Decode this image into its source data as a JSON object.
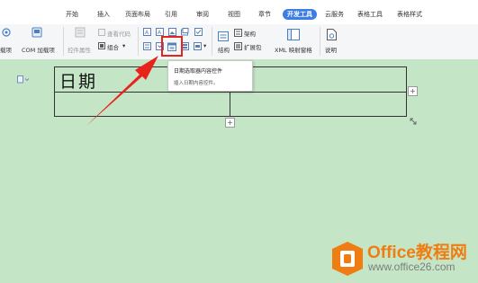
{
  "tabs": [
    {
      "label": "开始",
      "active": false
    },
    {
      "label": "插入",
      "active": false
    },
    {
      "label": "页面布局",
      "active": false
    },
    {
      "label": "引用",
      "active": false
    },
    {
      "label": "审阅",
      "active": false
    },
    {
      "label": "视图",
      "active": false
    },
    {
      "label": "章节",
      "active": false
    },
    {
      "label": "开发工具",
      "active": true
    },
    {
      "label": "云服务",
      "active": false
    },
    {
      "label": "表格工具",
      "active": false
    },
    {
      "label": "表格样式",
      "active": false
    }
  ],
  "ribbon": {
    "addin_partial": "载项",
    "com_addin": "COM 加载项",
    "control_properties": "控件属性",
    "view_code": "查看代码",
    "combine": "组合",
    "structure": "结构",
    "schema": "架构",
    "expansion_pack": "扩展包",
    "xml_mapping_pane": "XML 映射窗格",
    "help": "说明"
  },
  "document": {
    "cell_text": "日期",
    "add_symbol": "+"
  },
  "tooltip": {
    "title": "日期选取器内容控件",
    "description": "插入日期内容控件。"
  },
  "watermark": {
    "brand": "Office教程网",
    "url": "www.office26.com"
  },
  "colors": {
    "active_tab": "#3c7ee3",
    "document_bg": "#c5e6c6",
    "highlight": "#e8231c",
    "brand_orange": "#f07d12"
  }
}
